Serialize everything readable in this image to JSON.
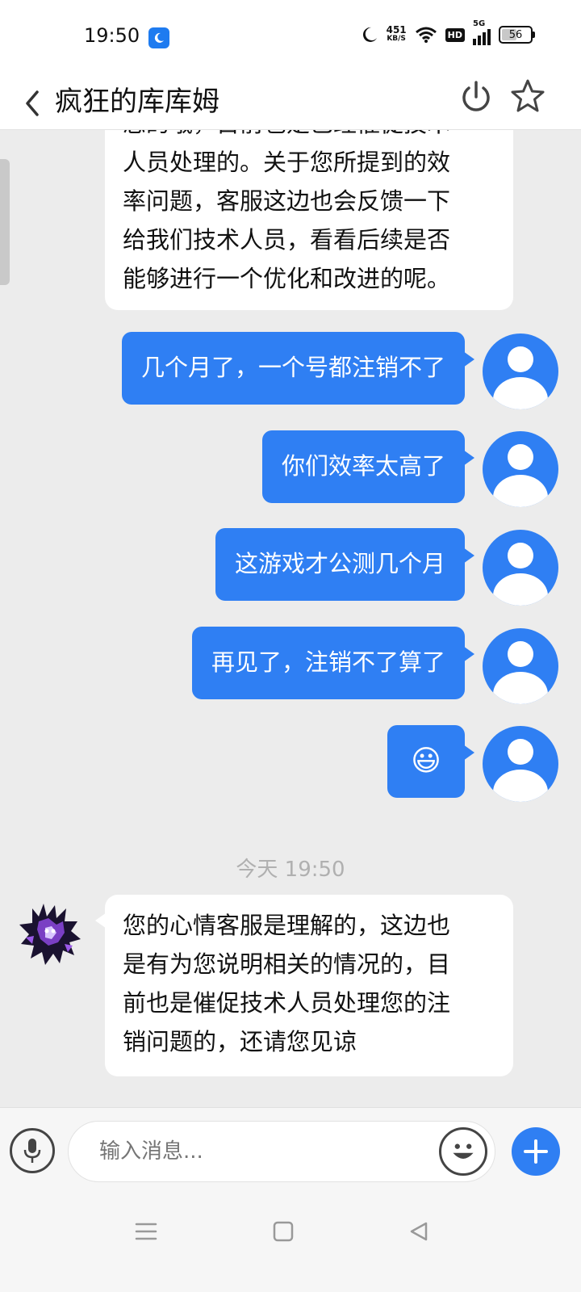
{
  "status_bar": {
    "time": "19:50",
    "net_speed": "451",
    "net_speed_unit": "KB/S",
    "hd_label": "HD",
    "network": "5G",
    "battery": "56",
    "battery_level": 0.56,
    "icons": [
      "moon-notification-icon",
      "do-not-disturb-moon-icon",
      "wifi-icon",
      "signal-icon",
      "battery-icon"
    ]
  },
  "header": {
    "title": "疯狂的库库姆",
    "icons": [
      "back-icon",
      "power-icon",
      "star-icon"
    ]
  },
  "messages": {
    "partial_in": [
      "您的哦，目前也是已经催促技术",
      "人员处理的。关于您所提到的效",
      "率问题，客服这边也会反馈一下",
      "给我们技术人员，看看后续是否",
      "能够进行一个优化和改进的呢。"
    ],
    "out": [
      "几个月了，一个号都注销不了",
      "你们效率太高了",
      "这游戏才公测几个月",
      "再见了，注销不了算了",
      "😃"
    ],
    "timestamp": "今天 19:50",
    "last_in": [
      "您的心情客服是理解的，这边也",
      "是有为您说明相关的情况的，目",
      "前也是催促技术人员处理您的注",
      "销问题的，还请您见谅"
    ]
  },
  "input_bar": {
    "placeholder": "输入消息...",
    "icons": [
      "microphone-icon",
      "emoji-icon",
      "plus-icon"
    ]
  },
  "nav_bar": {
    "icons": [
      "menu-icon",
      "home-icon",
      "back-nav-icon"
    ]
  },
  "colors": {
    "accent": "#2f7ff3",
    "chat_bg": "#ececec",
    "incoming_bubble": "#ffffff"
  }
}
